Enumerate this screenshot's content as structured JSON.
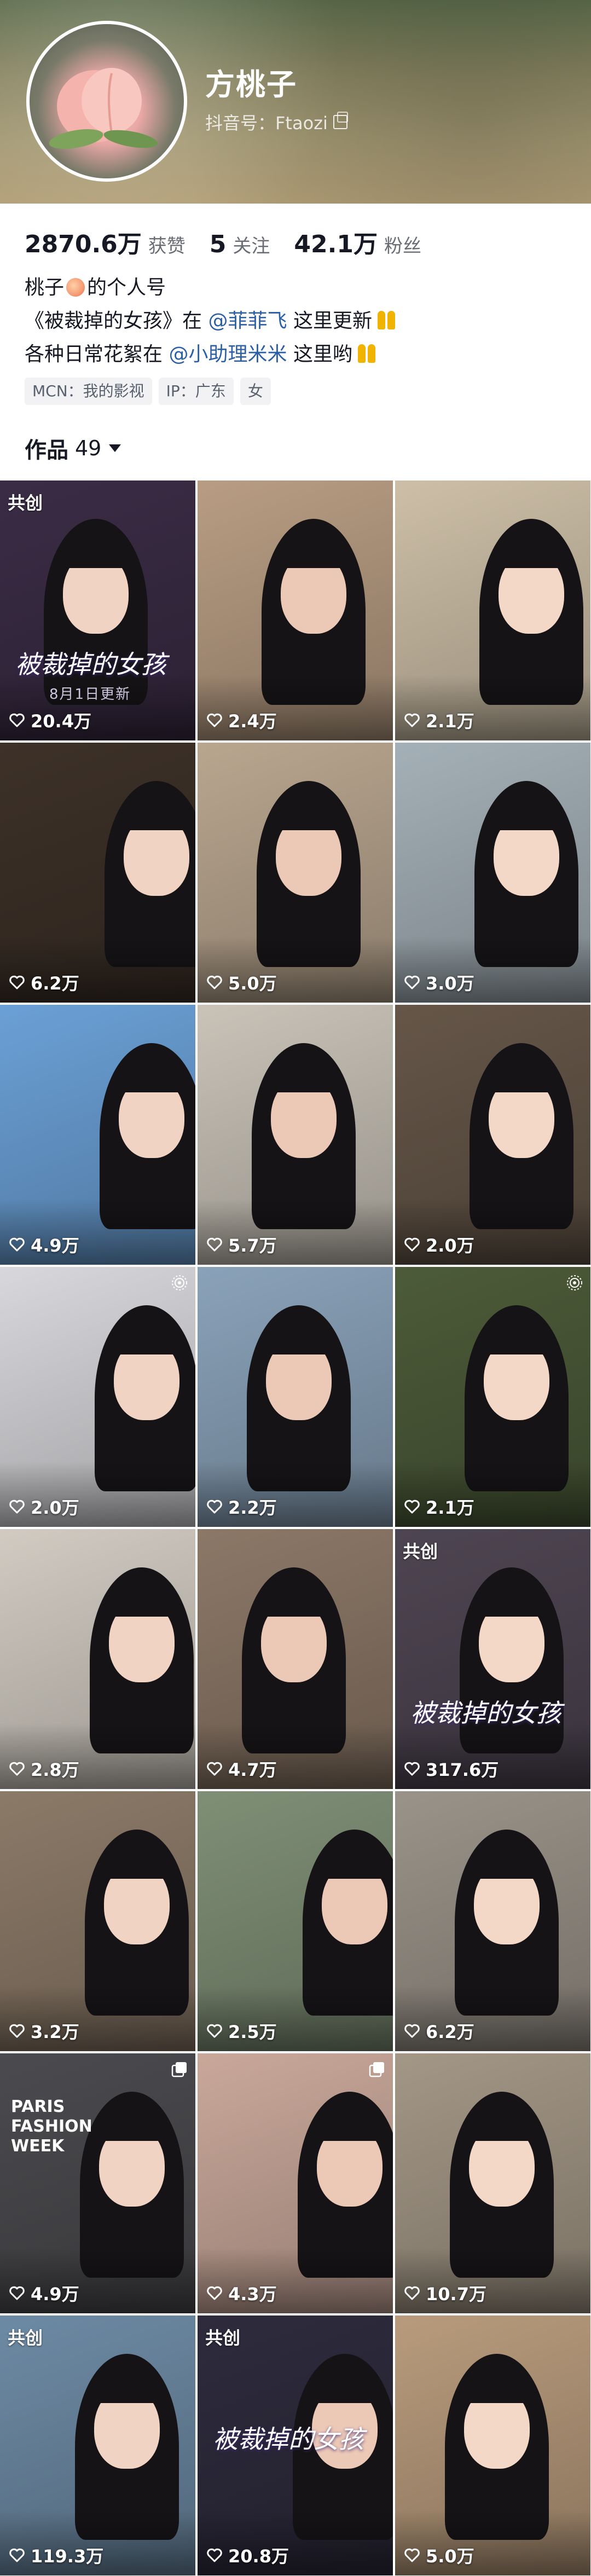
{
  "profile": {
    "name": "方桃子",
    "douyin_id": "抖音号：Ftaozi",
    "stats": [
      {
        "value": "2870.6万",
        "label": "获赞"
      },
      {
        "value": "5",
        "label": "关注"
      },
      {
        "value": "42.1万",
        "label": "粉丝"
      }
    ],
    "bio": {
      "line1_pre": "桃子",
      "line1_post": "的个人号",
      "line2_pre": "《被裁掉的女孩》在",
      "line2_mention": "@菲菲飞",
      "line2_post": "这里更新",
      "line3_pre": "各种日常花絮在",
      "line3_mention": "@小助理米米",
      "line3_post": "这里哟"
    },
    "tags": [
      "MCN：我的影视",
      "IP：广东",
      "女"
    ]
  },
  "works": {
    "label": "作品",
    "count": "49"
  },
  "videos": [
    {
      "likes": "20.4万",
      "badge": "共创",
      "poster": "被裁掉的女孩",
      "poster_sub": "8月1日更新",
      "bg": "#3a2c45"
    },
    {
      "likes": "2.4万",
      "bg": "#b89d83"
    },
    {
      "likes": "2.1万",
      "bg": "#cdbfa7"
    },
    {
      "likes": "6.2万",
      "bg": "#3d3128"
    },
    {
      "likes": "5.0万",
      "bg": "#b9a68f"
    },
    {
      "likes": "3.0万",
      "bg": "#a4b0b7"
    },
    {
      "likes": "4.9万",
      "bg": "#6ba0d6"
    },
    {
      "likes": "5.7万",
      "bg": "#c9c3b8"
    },
    {
      "likes": "2.0万",
      "bg": "#655648"
    },
    {
      "likes": "2.0万",
      "live_icon": true,
      "bg": "#d8d8dc"
    },
    {
      "likes": "2.2万",
      "bg": "#8aa2b9"
    },
    {
      "likes": "2.1万",
      "live_icon": true,
      "bg": "#4c5b39"
    },
    {
      "likes": "2.8万",
      "bg": "#d1cbc2"
    },
    {
      "likes": "4.7万",
      "bg": "#8c7867"
    },
    {
      "likes": "317.6万",
      "badge": "共创",
      "poster": "被裁掉的女孩",
      "bg": "#4e4552"
    },
    {
      "likes": "3.2万",
      "bg": "#8c7a68"
    },
    {
      "likes": "2.5万",
      "bg": "#7f8f76"
    },
    {
      "likes": "6.2万",
      "bg": "#9a9389"
    },
    {
      "likes": "4.9万",
      "multi_icon": true,
      "poster": "PARIS FASHION WEEK",
      "bg": "#4b4b4f"
    },
    {
      "likes": "4.3万",
      "multi_icon": true,
      "bg": "#c9a89a"
    },
    {
      "likes": "10.7万",
      "bg": "#a39786"
    },
    {
      "likes": "119.3万",
      "badge": "共创",
      "bg": "#6d8aa4"
    },
    {
      "likes": "20.8万",
      "badge": "共创",
      "poster": "被裁掉的女孩",
      "bg": "#2e2b3d"
    },
    {
      "likes": "5.0万",
      "bg": "#b89b7c"
    }
  ]
}
